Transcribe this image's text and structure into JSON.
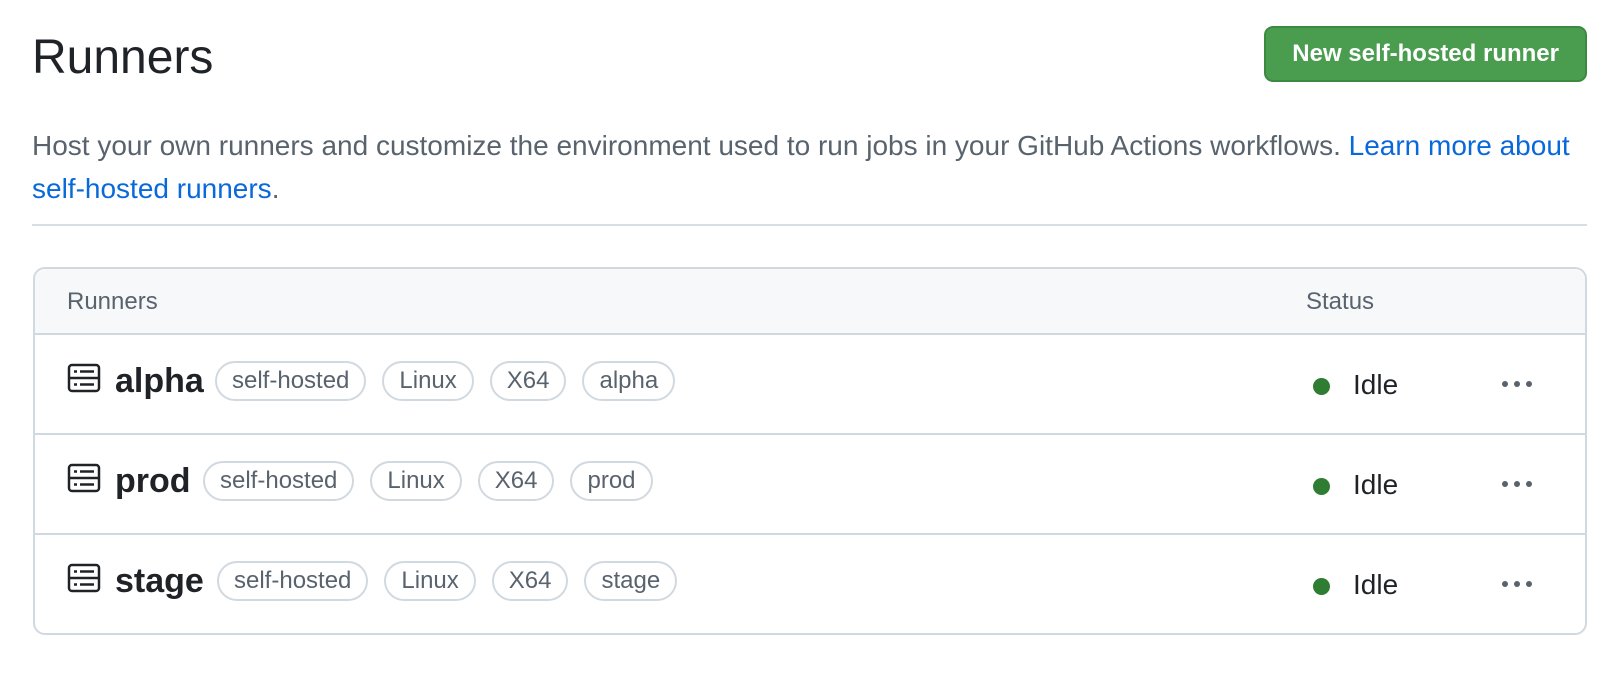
{
  "header": {
    "title": "Runners",
    "new_button_label": "New self-hosted runner"
  },
  "description": {
    "text": "Host your own runners and customize the environment used to run jobs in your GitHub Actions workflows. ",
    "link_text": "Learn more about self-hosted runners",
    "trailing": "."
  },
  "table": {
    "columns": {
      "runners": "Runners",
      "status": "Status"
    },
    "rows": [
      {
        "name": "alpha",
        "labels": [
          "self-hosted",
          "Linux",
          "X64",
          "alpha"
        ],
        "status": "Idle"
      },
      {
        "name": "prod",
        "labels": [
          "self-hosted",
          "Linux",
          "X64",
          "prod"
        ],
        "status": "Idle"
      },
      {
        "name": "stage",
        "labels": [
          "self-hosted",
          "Linux",
          "X64",
          "stage"
        ],
        "status": "Idle"
      }
    ]
  },
  "icons": {
    "runner": "server-icon",
    "menu": "kebab-horizontal-icon",
    "status": "status-dot-icon"
  },
  "colors": {
    "primary_button": "#4a9c4f",
    "link": "#0969da",
    "status_idle": "#2f7d32",
    "border": "#d1d9e0"
  }
}
